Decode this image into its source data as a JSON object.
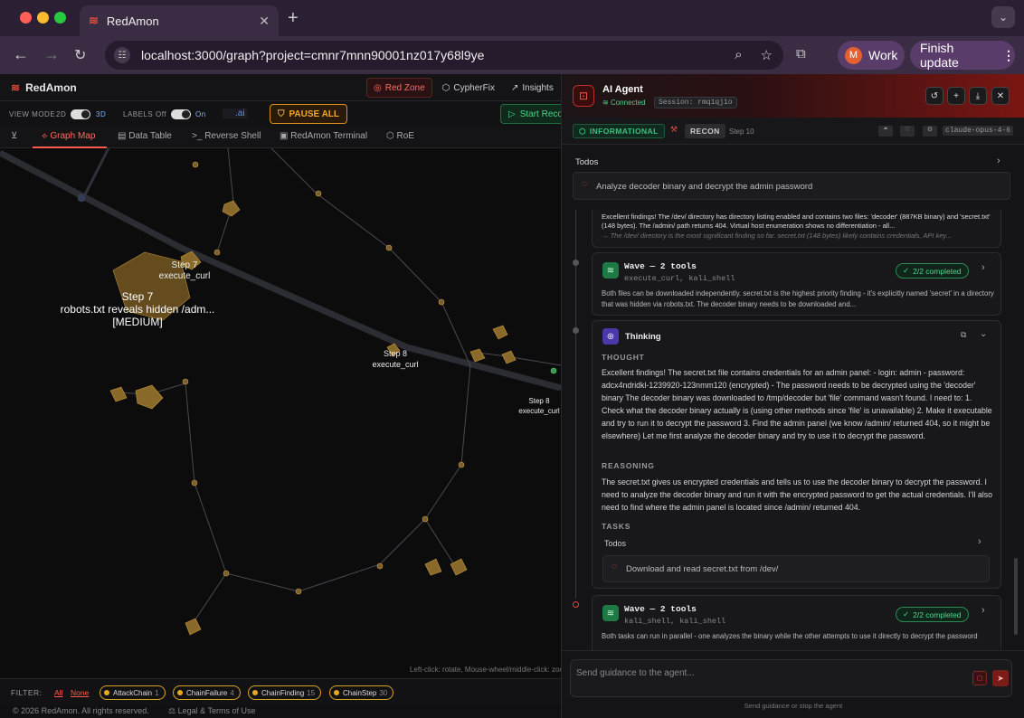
{
  "browser": {
    "tab_title": "RedAmon",
    "url": "localhost:3000/graph?project=cmnr7mnn90001nz017y68l9ye",
    "profile_label": "Work",
    "profile_initial": "M",
    "update_label": "Finish update"
  },
  "app": {
    "brand": "RedAmon",
    "nav": {
      "red_zone": "Red Zone",
      "cypherfix": "CypherFix",
      "insights": "Insights"
    },
    "controls": {
      "view_mode_label": "VIEW MODE",
      "view_2d": "2D",
      "view_3d": "3D",
      "labels_label": "LABELS",
      "labels_off": "Off",
      "labels_on": "On",
      "ai_tag": ".ai",
      "pause_label": "PAUSE ALL",
      "start_label": "Start Reco"
    },
    "view_tabs": [
      "Graph Map",
      "Data Table",
      "Reverse Shell",
      "RedAmon Terminal",
      "RoE"
    ],
    "graph": {
      "big_label": [
        "Step 7",
        "robots.txt reveals hidden /adm...",
        "[MEDIUM]"
      ],
      "node_a": [
        "Step 7",
        "execute_curl"
      ],
      "node_b": [
        "Step 8",
        "execute_curl"
      ],
      "node_c": [
        "Step 8",
        "execute_curl"
      ],
      "hint": "Left-click: rotate, Mouse-wheel/middle-click: zoom"
    },
    "filter": {
      "label": "FILTER:",
      "all": "All",
      "none": "None",
      "chips": [
        {
          "name": "AttackChain",
          "count": "1"
        },
        {
          "name": "ChainFailure",
          "count": "4"
        },
        {
          "name": "ChainFinding",
          "count": "15"
        },
        {
          "name": "ChainStep",
          "count": "30"
        }
      ]
    },
    "footer": {
      "copyright": "© 2026 RedAmon. All rights reserved.",
      "legal": "Legal & Terms of Use"
    }
  },
  "agent": {
    "title": "AI Agent",
    "status": "Connected",
    "session": "Session: rmq1qj1o",
    "risk": "INFORMATIONAL",
    "phase": "RECON",
    "step": "Step 10",
    "model": "claude-opus-4-6",
    "todos_label": "Todos",
    "todo_current": "Analyze decoder binary and decrypt the admin password",
    "prev_text": "Excellent findings! The /dev/ directory has directory listing enabled and contains two files: 'decoder' (887KB binary) and 'secret.txt' (148 bytes). The /admin/ path returns 404. Virtual host enumeration shows no differentiation - all...",
    "prev_italic": "→ The /dev/ directory is the most significant finding so far. secret.txt (148 bytes) likely contains credentials, API key...",
    "wave1": {
      "title": "Wave — 2 tools",
      "tools": "execute_curl, kali_shell",
      "status": "2/2 completed",
      "text": "Both files can be downloaded independently. secret.txt is the highest priority finding - it's explicitly named 'secret' in a directory that was hidden via robots.txt. The decoder binary needs to be downloaded and..."
    },
    "thinking": {
      "title": "Thinking",
      "thought_label": "THOUGHT",
      "thought": "Excellent findings! The secret.txt file contains credentials for an admin panel: - login: admin - password: adcx4ndridkl-1239920-123nmm120 (encrypted) - The password needs to be decrypted using the 'decoder' binary The decoder binary was downloaded to /tmp/decoder but 'file' command wasn't found. I need to: 1. Check what the decoder binary actually is (using other methods since 'file' is unavailable) 2. Make it executable and try to run it to decrypt the password 3. Find the admin panel (we know /admin/ returned 404, so it might be elsewhere) Let me first analyze the decoder binary and try to use it to decrypt the password.",
      "reasoning_label": "REASONING",
      "reasoning": "The secret.txt gives us encrypted credentials and tells us to use the decoder binary to decrypt the password. I need to analyze the decoder binary and run it with the encrypted password to get the actual credentials. I'll also need to find where the admin panel is located since /admin/ returned 404.",
      "tasks_label": "TASKS",
      "todos_label": "Todos",
      "task_item": "Download and read secret.txt from /dev/"
    },
    "wave2": {
      "title": "Wave — 2 tools",
      "tools": "kali_shell, kali_shell",
      "status": "2/2 completed",
      "text": "Both tasks can run in parallel - one analyzes the binary while the other attempts to use it directly to decrypt the password"
    },
    "input_placeholder": "Send guidance to the agent...",
    "input_hint": "Send guidance or stop the agent"
  }
}
